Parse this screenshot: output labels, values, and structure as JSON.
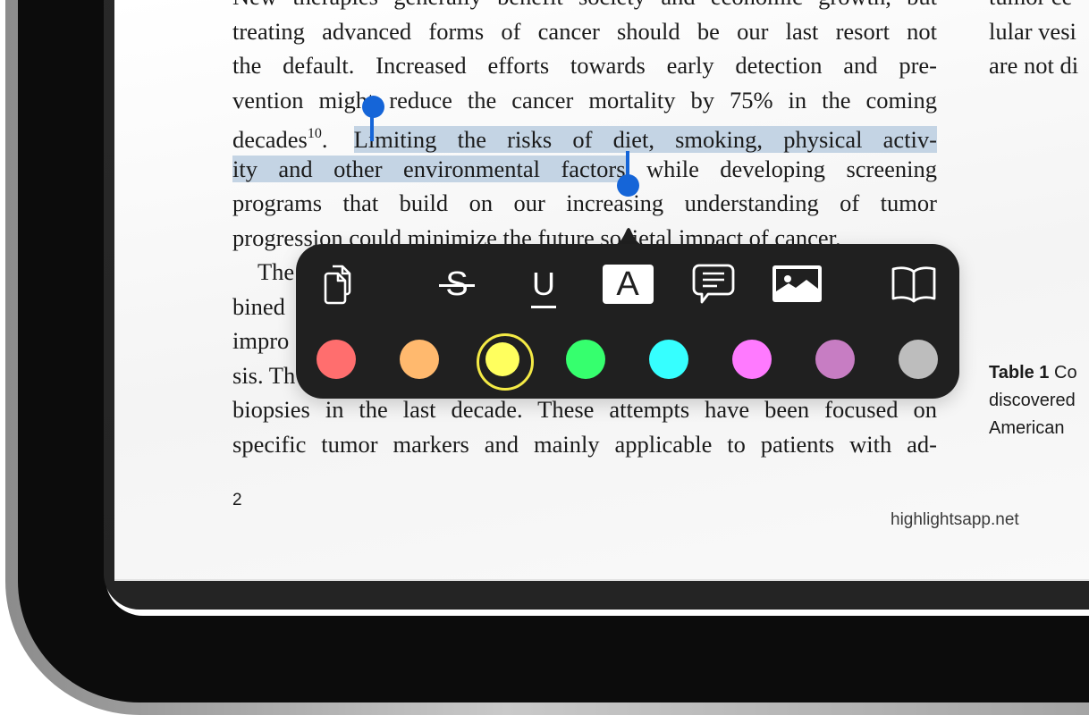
{
  "document": {
    "main_column_lines": [
      "New therapies generally benefit society and economic growth, but",
      "treating advanced forms of cancer should be our last resort not",
      "the default.  Increased efforts towards early detection and pre-",
      "vention might reduce the cancer mortality by 75% in the coming",
      "decades",
      "ity and other environmental factors",
      "programs that build on our increasing understanding of tumor",
      "progression could minimize the future societal impact of cancer.",
      "The",
      "bined",
      "impro",
      "sis. Th",
      "biopsies in the last decade.  These attempts have been focused on",
      "specific tumor markers and mainly applicable to patients with ad-"
    ],
    "citation_superscript": "10",
    "line5_before_selection": ". ",
    "selected_text_line5": "Limiting the risks of diet, smoking, physical activ-",
    "selected_text_line6": "ity and other environmental factors",
    "line6_after_selection": " while developing screening",
    "right_column_lines": [
      "tumor ce",
      "lular vesi",
      "are not di"
    ],
    "table_caption": {
      "label": "Table 1",
      "line1_rest": " Co",
      "line2": "discovered",
      "line3": "American"
    },
    "page_number": "2",
    "footer_url": "highlightsapp.net"
  },
  "selection": {
    "highlight_color": "#c4d4e4",
    "handle_color": "#1565d8"
  },
  "popup_menu": {
    "tools": [
      {
        "name": "copy",
        "icon": "copy-icon",
        "label": ""
      },
      {
        "name": "strikethrough",
        "icon": "strikethrough-icon",
        "label": "S"
      },
      {
        "name": "underline",
        "icon": "underline-icon",
        "label": "U"
      },
      {
        "name": "highlight",
        "icon": "highlight-icon",
        "label": "A",
        "active": true
      },
      {
        "name": "comment",
        "icon": "comment-icon",
        "label": ""
      },
      {
        "name": "image",
        "icon": "image-icon",
        "label": ""
      },
      {
        "name": "define",
        "icon": "book-icon",
        "label": ""
      }
    ],
    "colors": [
      {
        "name": "red",
        "hex": "#ff6e6e"
      },
      {
        "name": "orange",
        "hex": "#ffb96e"
      },
      {
        "name": "yellow",
        "hex": "#ffff5e",
        "selected": true
      },
      {
        "name": "green",
        "hex": "#36ff6e"
      },
      {
        "name": "cyan",
        "hex": "#36ffff"
      },
      {
        "name": "pink",
        "hex": "#ff7aff"
      },
      {
        "name": "purple",
        "hex": "#c77dc3"
      },
      {
        "name": "gray",
        "hex": "#bdbdbd"
      }
    ]
  }
}
